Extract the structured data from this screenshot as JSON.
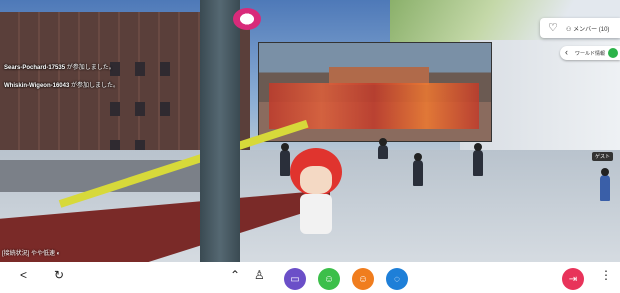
{
  "chat": {
    "messages": [
      {
        "name": "Sears-Pochard-17535",
        "text": "が参加しました。"
      },
      {
        "name": "Whiskin-Wigeon-16043",
        "text": "が参加しました。"
      }
    ]
  },
  "status_bar": {
    "text": "[接続状況] やや低速 ◐"
  },
  "top_right": {
    "members_label": "メンバー (10)",
    "heart_icon": "heart-icon",
    "sub_label": "ワールド情報"
  },
  "screen_labels": [
    "",
    "",
    ""
  ],
  "name_tag": "ゲスト",
  "toolbar": {
    "left_icons": [
      "share-icon",
      "rotate-icon"
    ],
    "center_buttons": [
      {
        "name": "chevron-up-icon",
        "color": "",
        "symbol": "⌃"
      },
      {
        "name": "person-icon",
        "color": "",
        "symbol": "🚶"
      },
      {
        "name": "camera-button",
        "color": "#6b4fc8",
        "symbol": "▭"
      },
      {
        "name": "emote-button",
        "color": "#3cbf4a",
        "symbol": "☺"
      },
      {
        "name": "emoji-button",
        "color": "#f07d1e",
        "symbol": "☺"
      },
      {
        "name": "chat-button",
        "color": "#1e7fd8",
        "symbol": "◌"
      }
    ],
    "exit_button": {
      "color": "#e8335a",
      "symbol": "⇥"
    },
    "more_icon": "⋮"
  },
  "colors": {
    "accent_green": "#2cb34a",
    "exit_red": "#e8335a"
  }
}
